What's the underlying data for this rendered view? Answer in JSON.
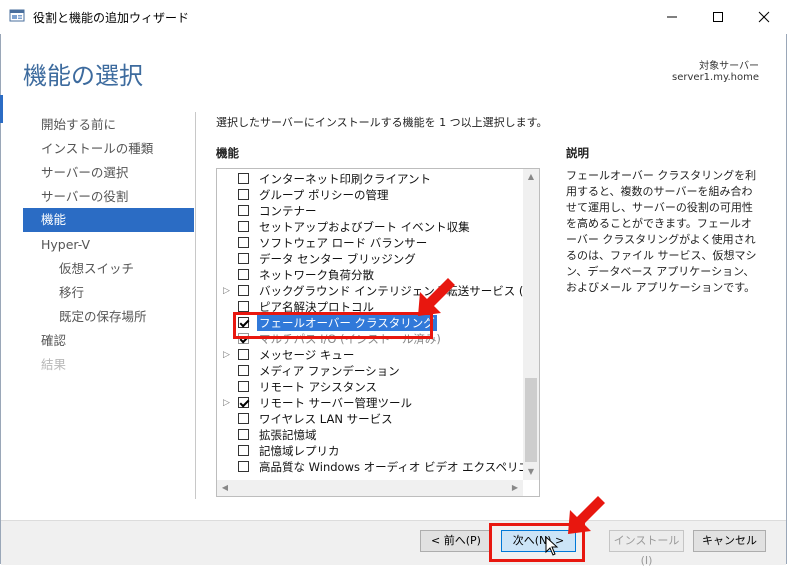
{
  "window": {
    "title": "役割と機能の追加ウィザード"
  },
  "header": {
    "page_title": "機能の選択",
    "target_label": "対象サーバー",
    "target_server": "server1.my.home"
  },
  "nav": {
    "items": [
      {
        "label": "開始する前に",
        "state": "normal",
        "level": 0
      },
      {
        "label": "インストールの種類",
        "state": "normal",
        "level": 0
      },
      {
        "label": "サーバーの選択",
        "state": "normal",
        "level": 0
      },
      {
        "label": "サーバーの役割",
        "state": "normal",
        "level": 0
      },
      {
        "label": "機能",
        "state": "active",
        "level": 0
      },
      {
        "label": "Hyper-V",
        "state": "normal",
        "level": 0
      },
      {
        "label": "仮想スイッチ",
        "state": "normal",
        "level": 1
      },
      {
        "label": "移行",
        "state": "normal",
        "level": 1
      },
      {
        "label": "既定の保存場所",
        "state": "normal",
        "level": 1
      },
      {
        "label": "確認",
        "state": "normal",
        "level": 0
      },
      {
        "label": "結果",
        "state": "disabled",
        "level": 0
      }
    ]
  },
  "main": {
    "instruction": "選択したサーバーにインストールする機能を 1 つ以上選択します。",
    "features_heading": "機能",
    "description_heading": "説明",
    "description": "フェールオーバー クラスタリングを利用すると、複数のサーバーを組み合わせて運用し、サーバーの役割の可用性を高めることができます。フェールオーバー クラスタリングがよく使用されるのは、ファイル サービス、仮想マシン、データベース アプリケーション、およびメール アプリケーションです。",
    "features": [
      {
        "label": "インターネット印刷クライアント",
        "checked": false,
        "expandable": false
      },
      {
        "label": "グループ ポリシーの管理",
        "checked": false,
        "expandable": false
      },
      {
        "label": "コンテナー",
        "checked": false,
        "expandable": false
      },
      {
        "label": "セットアップおよびブート イベント収集",
        "checked": false,
        "expandable": false
      },
      {
        "label": "ソフトウェア ロード バランサー",
        "checked": false,
        "expandable": false
      },
      {
        "label": "データ センター ブリッジング",
        "checked": false,
        "expandable": false
      },
      {
        "label": "ネットワーク負荷分散",
        "checked": false,
        "expandable": false
      },
      {
        "label": "バックグラウンド インテリジェント転送サービス (BITS)",
        "checked": false,
        "expandable": true
      },
      {
        "label": "ピア名解決プロトコル",
        "checked": false,
        "expandable": false
      },
      {
        "label": "フェールオーバー クラスタリング",
        "checked": true,
        "expandable": false,
        "selected": true
      },
      {
        "label": "マルチパス I/O (インストール済み)",
        "checked": true,
        "expandable": false,
        "installed": true
      },
      {
        "label": "メッセージ キュー",
        "checked": false,
        "expandable": true
      },
      {
        "label": "メディア ファンデーション",
        "checked": false,
        "expandable": false
      },
      {
        "label": "リモート アシスタンス",
        "checked": false,
        "expandable": false
      },
      {
        "label": "リモート サーバー管理ツール",
        "checked": true,
        "expandable": true
      },
      {
        "label": "ワイヤレス LAN サービス",
        "checked": false,
        "expandable": false
      },
      {
        "label": "拡張記憶域",
        "checked": false,
        "expandable": false
      },
      {
        "label": "記憶域レプリカ",
        "checked": false,
        "expandable": false
      },
      {
        "label": "高品質な Windows オーディオ ビデオ エクスペリエンス",
        "checked": false,
        "expandable": false
      }
    ]
  },
  "footer": {
    "prev_label": "< 前へ(P)",
    "next_label": "次へ(N) >",
    "install_label": "インストール(I)",
    "cancel_label": "キャンセル"
  },
  "colors": {
    "accent": "#2b6cc4",
    "heading": "#3d6b9e",
    "annotation": "#e8170f"
  }
}
